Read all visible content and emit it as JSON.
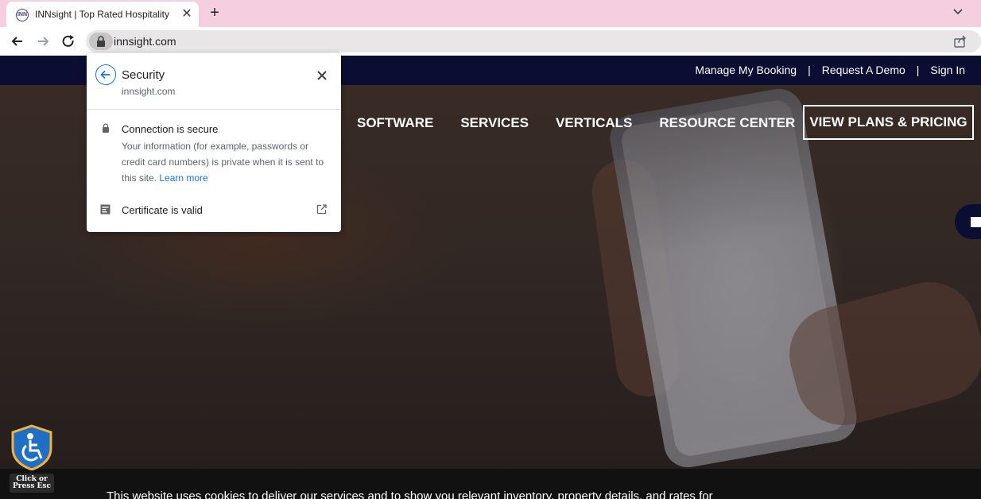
{
  "browser": {
    "tab": {
      "favicon_text": "INN",
      "title": "INNsight | Top Rated Hospitality",
      "close": "✕"
    },
    "new_tab": "+",
    "address": {
      "url": "innsight.com"
    }
  },
  "site": {
    "topbar": {
      "links": [
        "Manage My Booking",
        "Request A Demo",
        "Sign In"
      ],
      "separator": "|"
    },
    "nav": {
      "items": [
        "SOFTWARE",
        "SERVICES",
        "VERTICALS",
        "RESOURCE CENTER"
      ],
      "cta": "VIEW PLANS & PRICING"
    },
    "cookie_text": "This website uses cookies to deliver our services and to show you relevant inventory, property details, and rates for",
    "accessibility": {
      "line1": "Click or",
      "line2": "Press Esc"
    },
    "colors": {
      "topbar": "#0b0e32",
      "hero_overlay": "#2f2623"
    }
  },
  "security_popup": {
    "title": "Security",
    "host": "innsight.com",
    "connection_title": "Connection is secure",
    "connection_desc": "Your information (for example, passwords or credit card numbers) is private when it is sent to this site.",
    "learn_more": "Learn more",
    "certificate": "Certificate is valid",
    "accent": "#1a73e8"
  }
}
